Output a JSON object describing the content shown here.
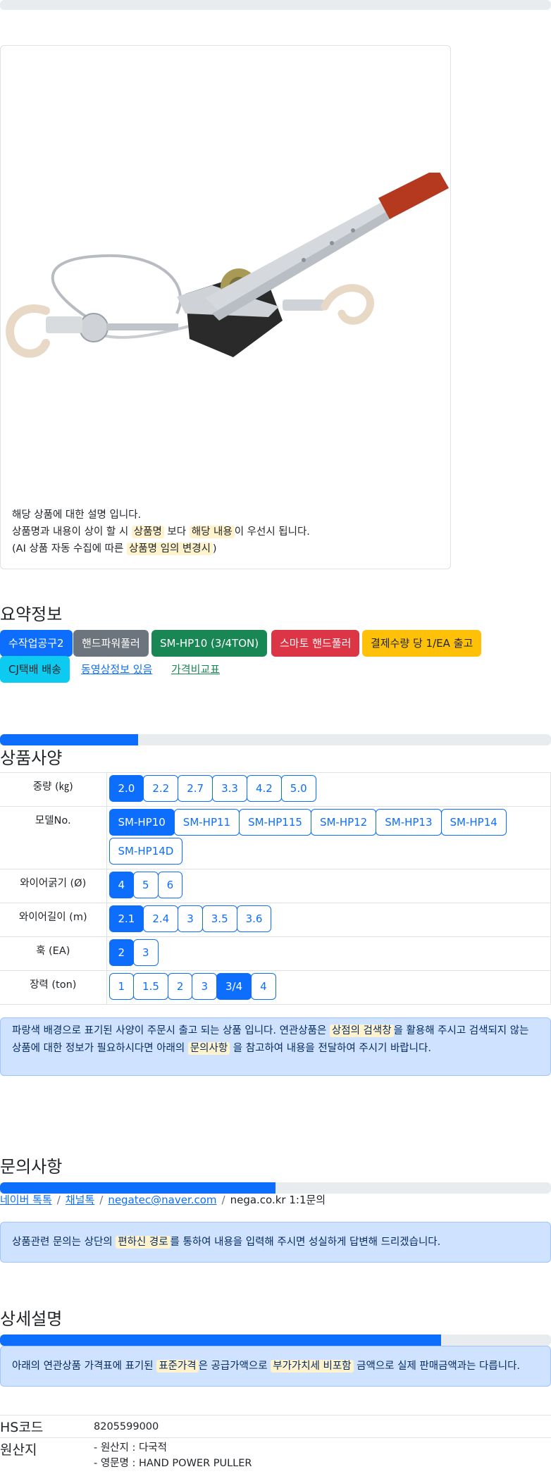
{
  "product_card": {
    "image_alt": "hand power puller product photo",
    "desc_line1": "해당 상품에 대한 설명 입니다.",
    "desc_line2_a": "상품명과 내용이 상이 할 시 ",
    "desc_line2_hl1": "상품명",
    "desc_line2_b": " 보다 ",
    "desc_line2_hl2": "해당 내용",
    "desc_line2_c": "이 우선시 됩니다.",
    "desc_line3_a": "(AI 상품 자동 수집에 따른 ",
    "desc_line3_hl": "상품명 임의 변경시",
    "desc_line3_b": ")"
  },
  "summary": {
    "title": "요약정보",
    "tags": [
      {
        "label": "수작업공구2",
        "color": "#0d6efd"
      },
      {
        "label": "핸드파워풀러",
        "color": "#6c757d"
      },
      {
        "label": "SM-HP10 (3/4TON)",
        "color": "#198754"
      },
      {
        "label": "스마토 핸드풀러",
        "color": "#dc3545"
      },
      {
        "label": "결제수량 당 1/EA 출고",
        "color": "#ffc107"
      },
      {
        "label": "CJ택배 배송",
        "color": "#0dcaf0"
      },
      {
        "label": "동영상정보 있음",
        "color": "link"
      },
      {
        "label": "가격비교표",
        "color": "#198754"
      }
    ]
  },
  "spec": {
    "title": "상품사양",
    "progress": 0.25,
    "rows": [
      {
        "label": "중량 (㎏)",
        "options": [
          "2.0",
          "2.2",
          "2.7",
          "3.3",
          "4.2",
          "5.0"
        ],
        "selected": "2.0"
      },
      {
        "label": "모델No.",
        "options": [
          "SM-HP10",
          "SM-HP11",
          "SM-HP115",
          "SM-HP12",
          "SM-HP13",
          "SM-HP14",
          "SM-HP14D"
        ],
        "selected": "SM-HP10"
      },
      {
        "label": "와이어굵기 (Ø)",
        "options": [
          "4",
          "5",
          "6"
        ],
        "selected": "4"
      },
      {
        "label": "와이어길이 (m)",
        "options": [
          "2.1",
          "2.4",
          "3",
          "3.5",
          "3.6"
        ],
        "selected": "2.1"
      },
      {
        "label": "훅 (EA)",
        "options": [
          "2",
          "3"
        ],
        "selected": "2"
      },
      {
        "label": "장력 (ton)",
        "options": [
          "1",
          "1.5",
          "2",
          "3",
          "3/4",
          "4"
        ],
        "selected": "3/4"
      }
    ],
    "notice_a": "파랑색 배경으로 표기된 사양이 주문시 출고 되는 상품 입니다. 연관상품은 ",
    "notice_hl1": "상점의 검색창",
    "notice_b": "을 활용해 주시고 검색되지 않는 상품에 대한 정보가 필요하시다면 아래의 ",
    "notice_hl2": "문의사항",
    "notice_c": " 을 참고하여 내용을 전달하여 주시기 바랍니다."
  },
  "inquiry": {
    "title": "문의사항",
    "progress": 0.5,
    "link1": "네이버 톡톡",
    "link2": "채널톡",
    "link3": "negatec@naver.com",
    "plain": "nega.co.kr 1:1문의",
    "notice_a": "상품관련 문의는 상단의 ",
    "notice_hl": "편하신 경로",
    "notice_b": "를 통하여 내용을 입력해 주시면 성실하게 답변해 드리겠습니다."
  },
  "detail": {
    "title": "상세설명",
    "progress": 0.8,
    "notice_a": "아래의 연관상품 가격표에 표기된 ",
    "notice_hl1": "표준가격",
    "notice_b": "은 공급가액으로 ",
    "notice_hl2": "부가가치세 비포함",
    "notice_c": " 금액으로 실제 판매금액과는 다릅니다.",
    "hs_key": "HS코드",
    "hs_val": "8205599000",
    "origin_key": "원산지",
    "origin_val1": "- 원산지 : 다국적",
    "origin_val2": "- 영문명 : HAND POWER PULLER"
  }
}
